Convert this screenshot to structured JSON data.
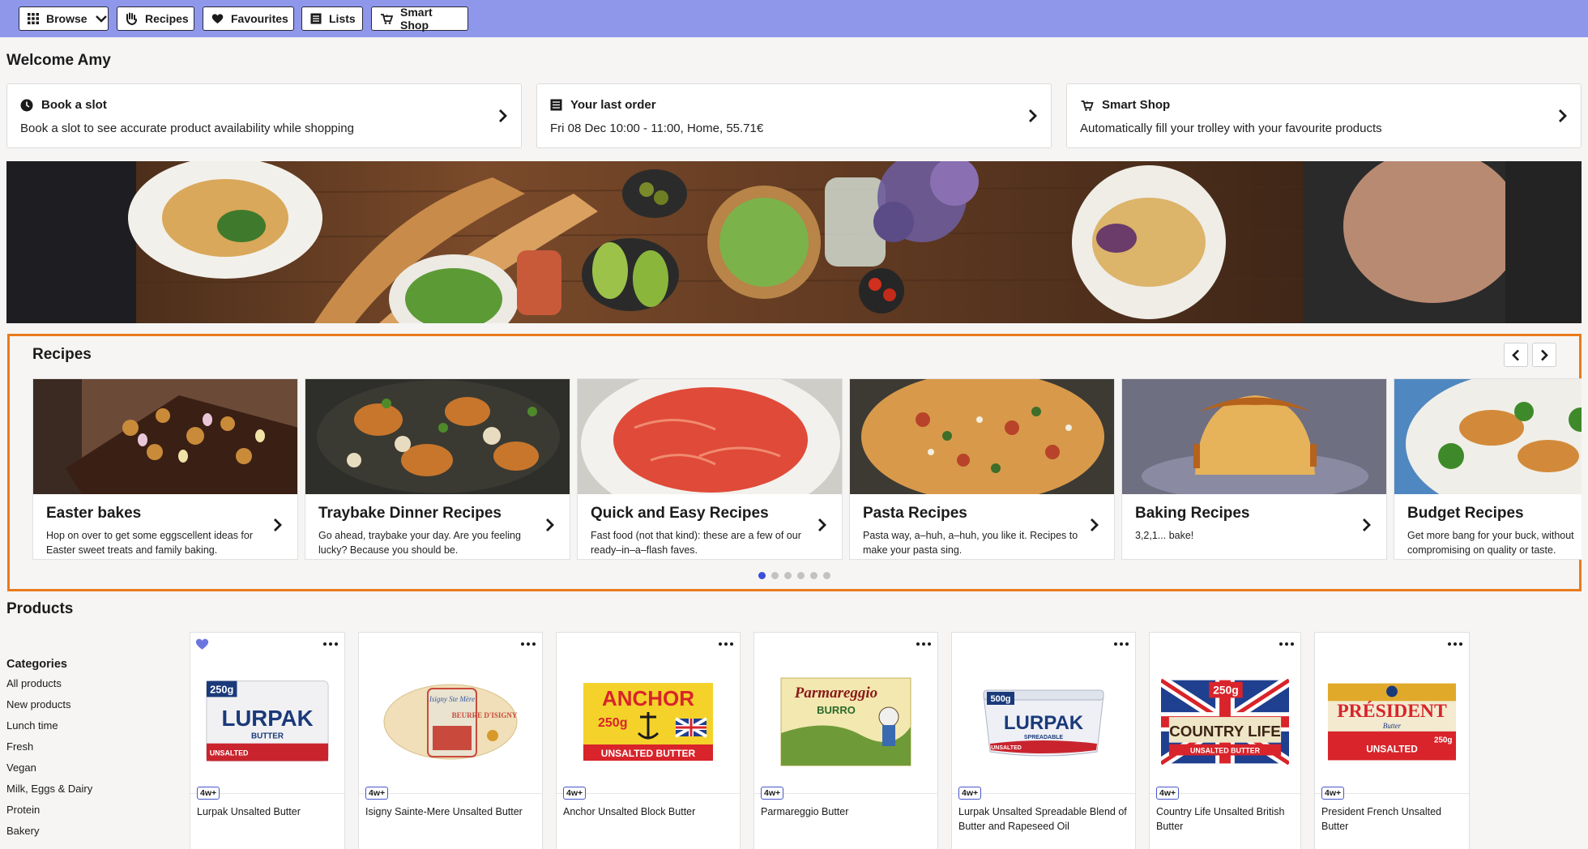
{
  "nav": {
    "browse": "Browse",
    "recipes": "Recipes",
    "favourites": "Favourites",
    "lists": "Lists",
    "smart_shop": "Smart Shop"
  },
  "welcome": "Welcome Amy",
  "cards": [
    {
      "title": "Book a slot",
      "subtitle": "Book a slot to see accurate product availability while shopping",
      "icon": "clock-icon"
    },
    {
      "title": "Your last order",
      "subtitle": "Fri 08 Dec 10:00 - 11:00, Home, 55.71€",
      "icon": "receipt-icon"
    },
    {
      "title": "Smart Shop",
      "subtitle": "Automatically fill your trolley with your favourite products",
      "icon": "smart-shop-icon"
    }
  ],
  "recipes": {
    "heading": "Recipes",
    "items": [
      {
        "title": "Easter bakes",
        "desc": "Hop on over to get some eggscellent ideas for Easter sweet treats and family baking."
      },
      {
        "title": "Traybake Dinner Recipes",
        "desc": "Go ahead, traybake your day. Are you feeling lucky? Because you should be."
      },
      {
        "title": "Quick and Easy Recipes",
        "desc": "Fast food (not that kind): these are a few of our ready–in–a–flash faves."
      },
      {
        "title": "Pasta Recipes",
        "desc": "Pasta way, a–huh, a–huh, you like it. Recipes to make your pasta sing."
      },
      {
        "title": "Baking Recipes",
        "desc": "3,2,1... bake!"
      },
      {
        "title": "Budget Recipes",
        "desc": "Get more bang for your buck, without compromising on quality or taste."
      }
    ],
    "pagination_count": 6,
    "active_page": 1
  },
  "products": {
    "heading": "Products",
    "categories_heading": "Categories",
    "categories": [
      "All products",
      "New products",
      "Lunch time",
      "Fresh",
      "Vegan",
      "Milk, Eggs & Dairy",
      "Protein",
      "Bakery"
    ],
    "items": [
      {
        "name": "Lurpak Unsalted Butter",
        "badge": "4w+",
        "favourite": true,
        "pack": {
          "brand": "LURPAK",
          "line2": "BUTTER",
          "line3": "UNSALTED",
          "size": "250g"
        }
      },
      {
        "name": "Isigny Sainte-Mere Unsalted Butter",
        "badge": "4w+",
        "favourite": false,
        "pack": {
          "brand": "BEURRE D'ISIGNY",
          "line2": "Isigny Ste Mère",
          "line3": "",
          "size": ""
        }
      },
      {
        "name": "Anchor Unsalted Block Butter",
        "badge": "4w+",
        "favourite": false,
        "pack": {
          "brand": "ANCHOR",
          "line2": "250g",
          "line3": "UNSALTED BUTTER",
          "size": ""
        }
      },
      {
        "name": "Parmareggio Butter",
        "badge": "4w+",
        "favourite": false,
        "pack": {
          "brand": "Parmareggio",
          "line2": "BURRO",
          "line3": "",
          "size": ""
        }
      },
      {
        "name": "Lurpak Unsalted Spreadable Blend of Butter and Rapeseed Oil",
        "badge": "4w+",
        "favourite": false,
        "pack": {
          "brand": "LURPAK",
          "line2": "SPREADABLE",
          "line3": "UNSALTED",
          "size": "500g"
        }
      },
      {
        "name": "Country Life Unsalted British Butter",
        "badge": "4w+",
        "favourite": false,
        "pack": {
          "brand": "COUNTRY LIFE",
          "line2": "UNSALTED BUTTER",
          "line3": "",
          "size": "250g"
        }
      },
      {
        "name": "President French Unsalted Butter",
        "badge": "4w+",
        "favourite": false,
        "pack": {
          "brand": "PRÉSIDENT",
          "line2": "Butter",
          "line3": "UNSALTED",
          "size": "250g"
        }
      }
    ]
  },
  "colors": {
    "topbar": "#8e97ea",
    "highlight_border": "#ea7a1c",
    "accent": "#3b4fd9"
  }
}
